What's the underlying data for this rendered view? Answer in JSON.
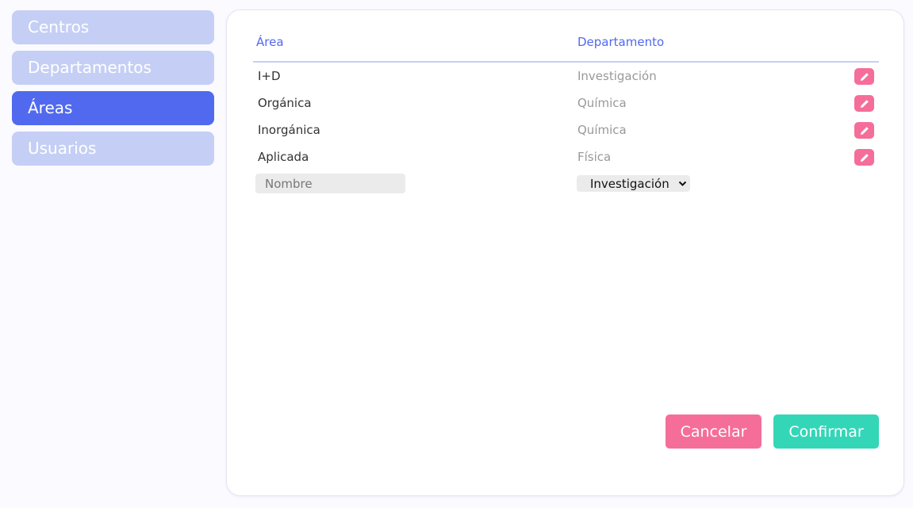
{
  "sidebar": {
    "items": [
      {
        "label": "Centros"
      },
      {
        "label": "Departamentos"
      },
      {
        "label": "Áreas"
      },
      {
        "label": "Usuarios"
      }
    ],
    "active_index": 2
  },
  "table": {
    "headers": {
      "area": "Área",
      "departamento": "Departamento"
    },
    "rows": [
      {
        "area": "I+D",
        "departamento": "Investigación"
      },
      {
        "area": "Orgánica",
        "departamento": "Química"
      },
      {
        "area": "Inorgánica",
        "departamento": "Química"
      },
      {
        "area": "Aplicada",
        "departamento": "Física"
      }
    ]
  },
  "new_row": {
    "name_placeholder": "Nombre",
    "name_value": "",
    "department_selected": "Investigación"
  },
  "actions": {
    "cancel_label": "Cancelar",
    "confirm_label": "Confirmar"
  },
  "icons": {
    "edit": "pencil-icon",
    "dropdown": "chevron-down-icon"
  },
  "colors": {
    "accent": "#5069ee",
    "nav_inactive": "#c5cff5",
    "edit_button": "#f56e9a",
    "cancel": "#f56e9a",
    "confirm": "#34d6b8"
  }
}
